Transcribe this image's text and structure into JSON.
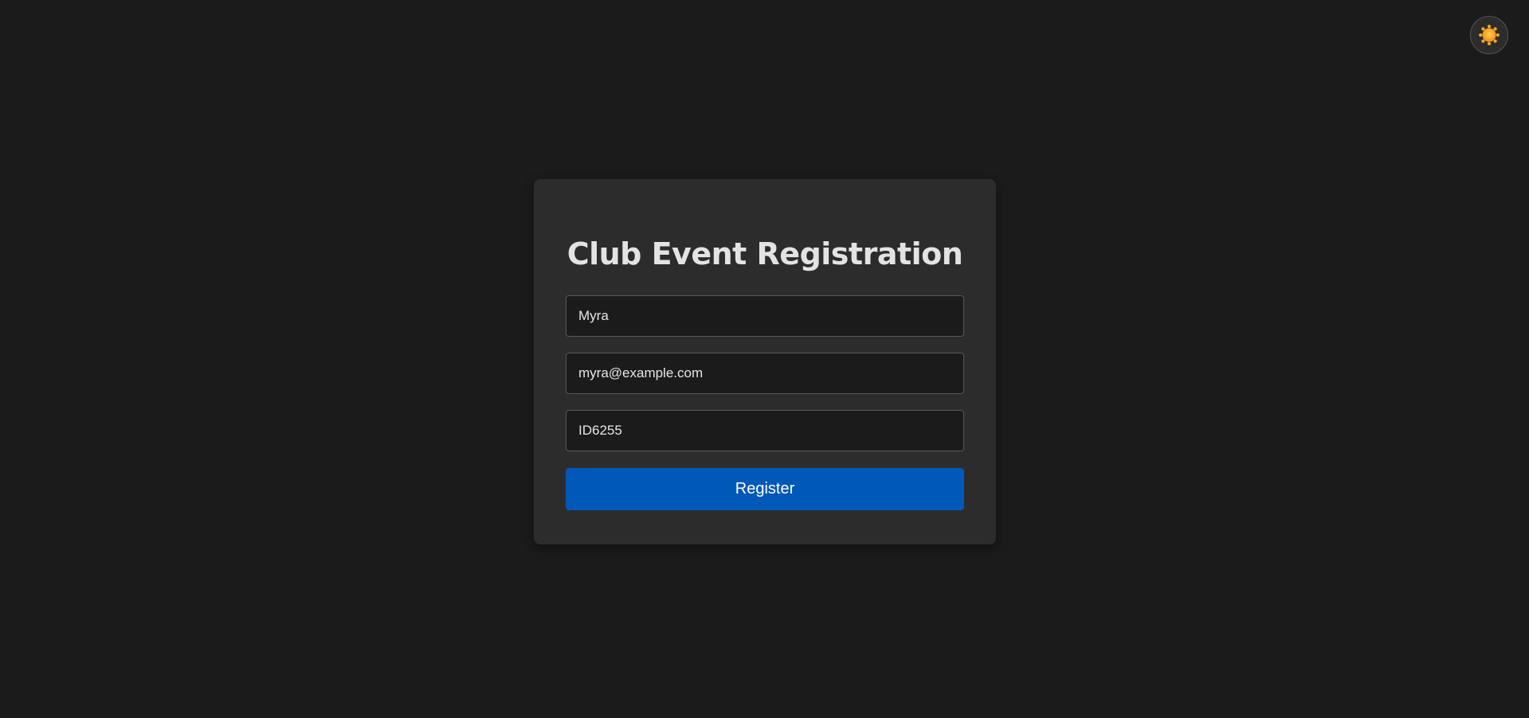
{
  "theme_toggle": {
    "icon": "sun-icon",
    "icon_color": "#f5a623"
  },
  "form": {
    "title": "Club Event Registration",
    "name_value": "Myra",
    "email_value": "myra@example.com",
    "member_id_value": "ID6255",
    "submit_label": "Register"
  },
  "colors": {
    "background": "#1b1b1b",
    "card": "#2c2c2c",
    "accent": "#0059b8",
    "text": "#e3e3e3"
  }
}
